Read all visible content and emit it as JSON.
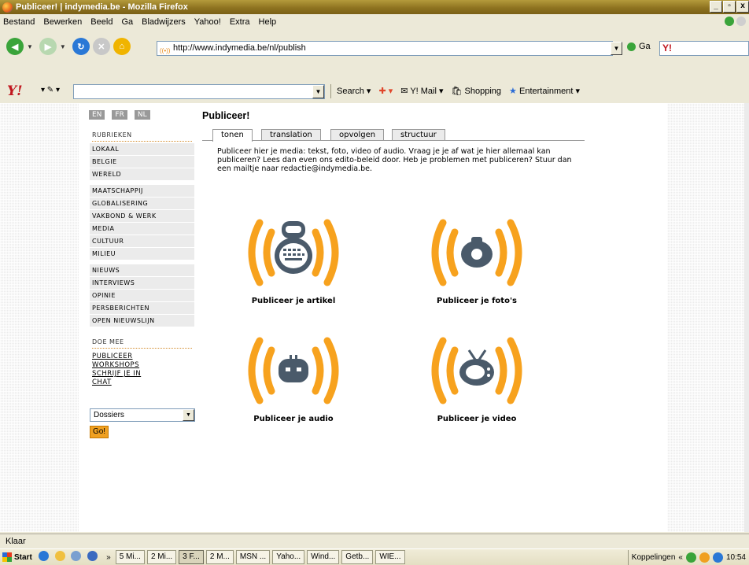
{
  "window": {
    "title": "Publiceer! | indymedia.be - Mozilla Firefox",
    "min": "_",
    "max": "▫",
    "close": "x"
  },
  "menu": [
    "Bestand",
    "Bewerken",
    "Beeld",
    "Ga",
    "Bladwijzers",
    "Yahoo!",
    "Extra",
    "Help"
  ],
  "nav": {
    "url": "http://www.indymedia.be/nl/publish",
    "go_label": "Ga",
    "search_logo": "Y!"
  },
  "ytoolbar": {
    "logo": "Y!",
    "search_label": "Search",
    "mail_label": "Y! Mail",
    "shopping_label": "Shopping",
    "entertainment_label": "Entertainment"
  },
  "sidebar": {
    "languages": [
      "EN",
      "FR",
      "NL"
    ],
    "rubrieken_heading": "RUBRIEKEN",
    "group1": [
      "LOKAAL",
      "BELGIE",
      "WERELD"
    ],
    "group2": [
      "MAATSCHAPPIJ",
      "GLOBALISERING",
      "VAKBOND & WERK",
      "MEDIA",
      "CULTUUR",
      "MILIEU"
    ],
    "group3": [
      "NIEUWS",
      "INTERVIEWS",
      "OPINIE",
      "PERSBERICHTEN",
      "OPEN NIEUWSLIJN"
    ],
    "doe_mee_heading": "DOE MEE",
    "doe_mee_links": [
      "PUBLICEER",
      "WORKSHOPS",
      "SCHRIJF JE IN",
      "CHAT"
    ],
    "dossiers_value": "Dossiers",
    "go_label": "Go!"
  },
  "main": {
    "title": "Publiceer!",
    "tabs": [
      "tonen",
      "translation",
      "opvolgen",
      "structuur"
    ],
    "intro": "Publiceer hier je media: tekst, foto, video of audio. Vraag je je af wat je hier allemaal kan publiceren? Lees dan even ons edito-beleid door. Heb je problemen met publiceren? Stuur dan een mailtje naar redactie@indymedia.be.",
    "cards": [
      {
        "label": "Publiceer je artikel",
        "icon": "keyboard-robot-icon"
      },
      {
        "label": "Publiceer je foto's",
        "icon": "camera-icon"
      },
      {
        "label": "Publiceer je audio",
        "icon": "radio-icon"
      },
      {
        "label": "Publiceer je video",
        "icon": "tv-icon"
      }
    ],
    "accent_color": "#f7a21e",
    "icon_color": "#4a5a6a"
  },
  "status": {
    "text": "Klaar"
  },
  "taskbar": {
    "start": "Start",
    "more": "»",
    "tasks": [
      "5 Mi...",
      "2 Mi...",
      "3 F...",
      "2 M...",
      "MSN ...",
      "Yaho...",
      "Wind...",
      "Getb...",
      "WIE..."
    ],
    "links_label": "Koppelingen",
    "links_more": "«",
    "clock": "10:54"
  }
}
